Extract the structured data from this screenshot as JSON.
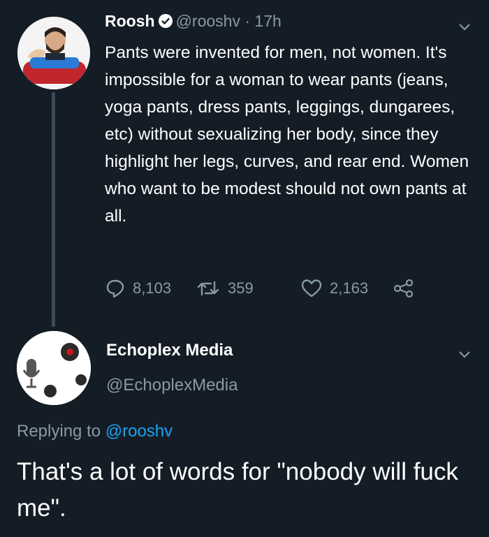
{
  "tweet1": {
    "name": "Roosh",
    "handle": "@rooshv",
    "separator": "·",
    "time": "17h",
    "text": "Pants were invented for men, not women. It's impossible for a woman to wear pants (jeans, yoga pants, dress pants, leggings, dungarees, etc) without sexualizing her body, since they highlight her legs, curves, and rear end. Women who want to be modest should not own pants at all.",
    "replies": "8,103",
    "retweets": "359",
    "likes": "2,163",
    "icons": [
      "verified-icon",
      "chevron-down-icon",
      "reply-icon",
      "retweet-icon",
      "like-icon",
      "share-icon"
    ]
  },
  "tweet2": {
    "name": "Echoplex Media",
    "handle": "@EchoplexMedia",
    "replying_label": "Replying to",
    "replying_handle": "@rooshv",
    "text": "That's a lot of words for \"nobody will fuck me\".",
    "icons": [
      "chevron-down-icon"
    ]
  },
  "colors": {
    "background": "#141d26",
    "secondary_text": "#8899a6",
    "link": "#1da1f2",
    "thread_line": "#3d4b58"
  }
}
